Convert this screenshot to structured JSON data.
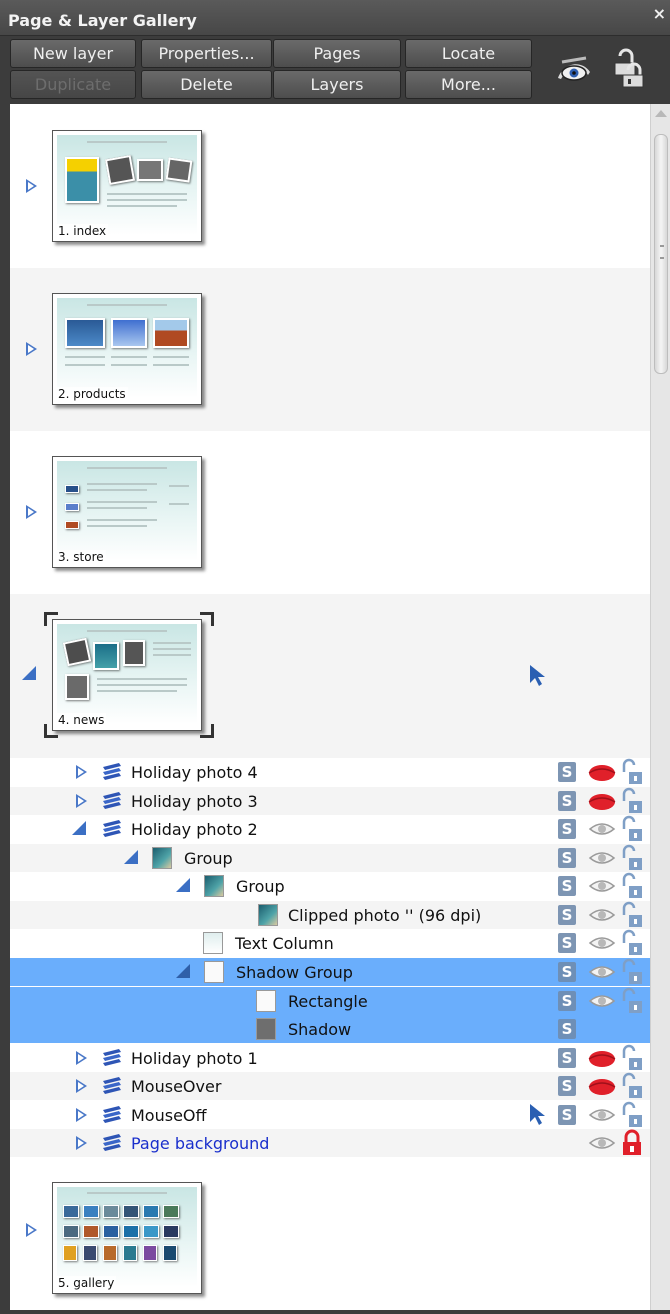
{
  "panel": {
    "title": "Page & Layer Gallery",
    "close_symbol": "×"
  },
  "toolbar": {
    "buttons": [
      {
        "label": "New layer",
        "enabled": true
      },
      {
        "label": "Properties...",
        "enabled": true
      },
      {
        "label": "Pages",
        "enabled": true
      },
      {
        "label": "Locate",
        "enabled": true
      },
      {
        "label": "Duplicate",
        "enabled": false
      },
      {
        "label": "Delete",
        "enabled": true
      },
      {
        "label": "Layers",
        "enabled": true
      },
      {
        "label": "More...",
        "enabled": true
      }
    ],
    "icons": [
      "show-all-layers-icon",
      "page-layer-options-icon"
    ]
  },
  "pages": [
    {
      "label": "1. index",
      "expanded": false
    },
    {
      "label": "2. products",
      "expanded": false
    },
    {
      "label": "3. store",
      "expanded": false
    },
    {
      "label": "4. news",
      "expanded": true,
      "selected": true
    },
    {
      "label": "5. gallery",
      "expanded": false
    }
  ],
  "layers": [
    {
      "name": "Holiday photo 4",
      "kind": "layer",
      "expander": "closed",
      "selected": false,
      "visibility": "hidden",
      "show_s": true,
      "show_eye": true,
      "lock": "unlocked"
    },
    {
      "name": "Holiday photo 3",
      "kind": "layer",
      "expander": "closed",
      "selected": false,
      "visibility": "hidden",
      "show_s": true,
      "show_eye": true,
      "lock": "unlocked"
    },
    {
      "name": "Holiday photo 2",
      "kind": "layer",
      "expander": "open",
      "selected": false,
      "visibility": "visible",
      "show_s": true,
      "show_eye": true,
      "lock": "unlocked"
    },
    {
      "name": "Group",
      "kind": "group",
      "expander": "open",
      "selected": false,
      "visibility": "visible",
      "show_s": true,
      "show_eye": true,
      "lock": "unlocked"
    },
    {
      "name": "Group",
      "kind": "group",
      "expander": "open",
      "selected": false,
      "visibility": "visible",
      "show_s": true,
      "show_eye": true,
      "lock": "unlocked"
    },
    {
      "name": "Clipped photo '' (96 dpi)",
      "kind": "photo",
      "expander": "none",
      "selected": false,
      "visibility": "visible",
      "show_s": true,
      "show_eye": true,
      "lock": "unlocked"
    },
    {
      "name": "Text Column",
      "kind": "text",
      "expander": "none",
      "selected": false,
      "visibility": "visible",
      "show_s": true,
      "show_eye": true,
      "lock": "unlocked"
    },
    {
      "name": "Shadow Group",
      "kind": "shape",
      "expander": "open",
      "selected": true,
      "visibility": "visible",
      "show_s": true,
      "show_eye": true,
      "lock": "unlocked"
    },
    {
      "name": "Rectangle",
      "kind": "shape",
      "expander": "none",
      "selected": true,
      "visibility": "visible",
      "show_s": true,
      "show_eye": true,
      "lock": "unlocked"
    },
    {
      "name": "Shadow",
      "kind": "shadow",
      "expander": "none",
      "selected": true,
      "visibility": "none",
      "show_s": true,
      "show_eye": false,
      "lock": "none"
    },
    {
      "name": "Holiday photo 1",
      "kind": "layer",
      "expander": "closed",
      "selected": false,
      "visibility": "hidden",
      "show_s": true,
      "show_eye": true,
      "lock": "unlocked"
    },
    {
      "name": "MouseOver",
      "kind": "layer",
      "expander": "closed",
      "selected": false,
      "visibility": "hidden",
      "show_s": true,
      "show_eye": true,
      "lock": "unlocked"
    },
    {
      "name": "MouseOff",
      "kind": "layer",
      "expander": "closed",
      "selected": false,
      "visibility": "visible",
      "show_s": true,
      "show_eye": true,
      "lock": "unlocked",
      "active_pointer": true
    },
    {
      "name": "Page background",
      "kind": "layer",
      "expander": "closed",
      "selected": false,
      "visibility": "visible",
      "show_s": false,
      "show_eye": true,
      "lock": "locked",
      "background": true
    }
  ],
  "colors": {
    "selection": "#6aaefc",
    "expander_blue": "#4a78c8",
    "hidden_eye_red": "#e0202a",
    "background_layer_text": "#1a2fcc"
  }
}
